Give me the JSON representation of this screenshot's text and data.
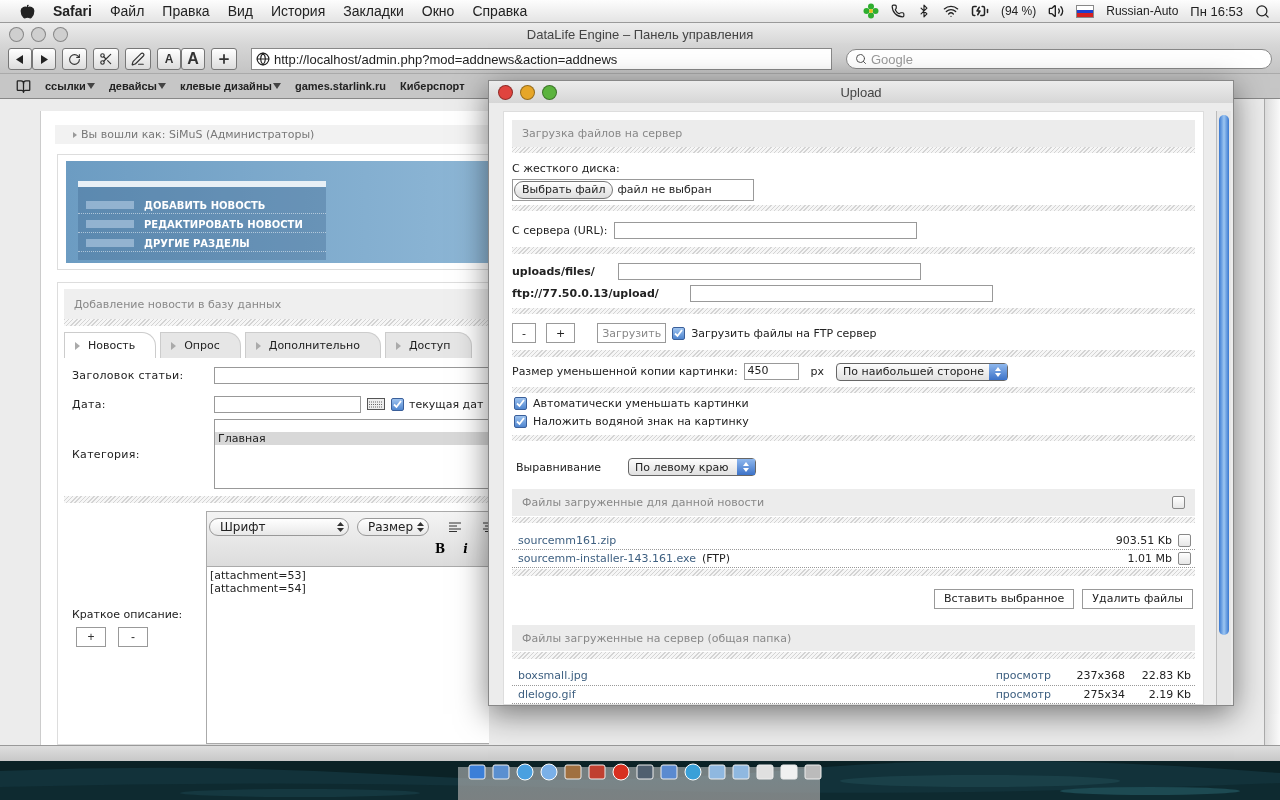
{
  "menu_bar": {
    "app": "Safari",
    "menus": [
      "Файл",
      "Правка",
      "Вид",
      "История",
      "Закладки",
      "Окно",
      "Справка"
    ],
    "battery": "(94 %)",
    "input_source": "Russian-Auto",
    "clock": "Пн 16:53"
  },
  "browser": {
    "title": "DataLife Engine – Панель управления",
    "font_buttons": [
      "A",
      "A"
    ],
    "url": "http://localhost/admin.php?mod=addnews&action=addnews",
    "search_placeholder": "Google",
    "bookmarks": [
      {
        "label": "ссылки",
        "menu": true
      },
      {
        "label": "девайсы",
        "menu": true
      },
      {
        "label": "клевые дизайны",
        "menu": true
      },
      {
        "label": "games.starlink.ru",
        "menu": false
      },
      {
        "label": "Киберспорт",
        "menu": false
      }
    ]
  },
  "page": {
    "login": "Вы вошли как: SiMuS (Администраторы)",
    "nav": [
      "ДОБАВИТЬ НОВОСТЬ",
      "РЕДАКТИРОВАТЬ НОВОСТИ",
      "ДРУГИЕ РАЗДЕЛЫ"
    ],
    "section_title": "Добавление новости в базу данных",
    "tabs": [
      {
        "label": "Новость",
        "selected": true
      },
      {
        "label": "Опрос",
        "selected": false
      },
      {
        "label": "Дополнительно",
        "selected": false
      },
      {
        "label": "Доступ",
        "selected": false
      }
    ],
    "title_label": "Заголовок статьи:",
    "date_label": "Дата:",
    "current_date": {
      "label": "текущая дат",
      "checked": true
    },
    "category_label": "Категория:",
    "categories": [
      {
        "label": "Главная",
        "selected": true
      }
    ],
    "short_label": "Краткое описание:",
    "size_buttons": [
      "+",
      "-"
    ],
    "font_select": "Шрифт",
    "size_select": "Размер",
    "bold": "B",
    "italic": "i",
    "short_text": "[attachment=53]\n[attachment=54]"
  },
  "upload": {
    "title": "Upload",
    "section": "Загрузка файлов на сервер",
    "disk_label": "С жесткого диска:",
    "choose_button": "Выбрать файл",
    "no_file": "файл не выбран",
    "url_label": "С сервера (URL):",
    "local_path": "uploads/files/",
    "ftp_path": "ftp://77.50.0.13/upload/",
    "row_buttons": [
      "-",
      "+"
    ],
    "upload_button": {
      "label": "Загрузить",
      "disabled": true
    },
    "ftp_check": {
      "label": "Загрузить файлы на FTP сервер",
      "checked": true
    },
    "thumb_label": "Размер уменьшенной копии картинки:",
    "thumb_value": "450",
    "thumb_unit": "px",
    "thumb_mode": "По наибольшей стороне",
    "options": [
      {
        "label": "Автоматически уменьшать картинки",
        "checked": true
      },
      {
        "label": "Наложить водяной знак на картинку",
        "checked": true
      }
    ],
    "align_label": "Выравнивание",
    "align_value": "По левому краю",
    "news_files_title": "Файлы загруженные для данной новости",
    "news_files_all": false,
    "news_files": [
      {
        "name": "sourcemm161.zip",
        "size": "903.51 Kb",
        "checked": false
      },
      {
        "name": "sourcemm-installer-143.161.exe",
        "note": "(FTP)",
        "size": "1.01 Mb",
        "checked": false
      }
    ],
    "actions": [
      "Вставить выбранное",
      "Удалить файлы"
    ],
    "server_files_title": "Файлы загруженные на сервер (общая папка)",
    "server_files": [
      {
        "name": "boxsmall.jpg",
        "view": "просмотр",
        "dims": "237x368",
        "size": "22.83 Kb"
      },
      {
        "name": "dlelogo.gif",
        "view": "просмотр",
        "dims": "275x34",
        "size": "2.19 Kb"
      }
    ]
  }
}
